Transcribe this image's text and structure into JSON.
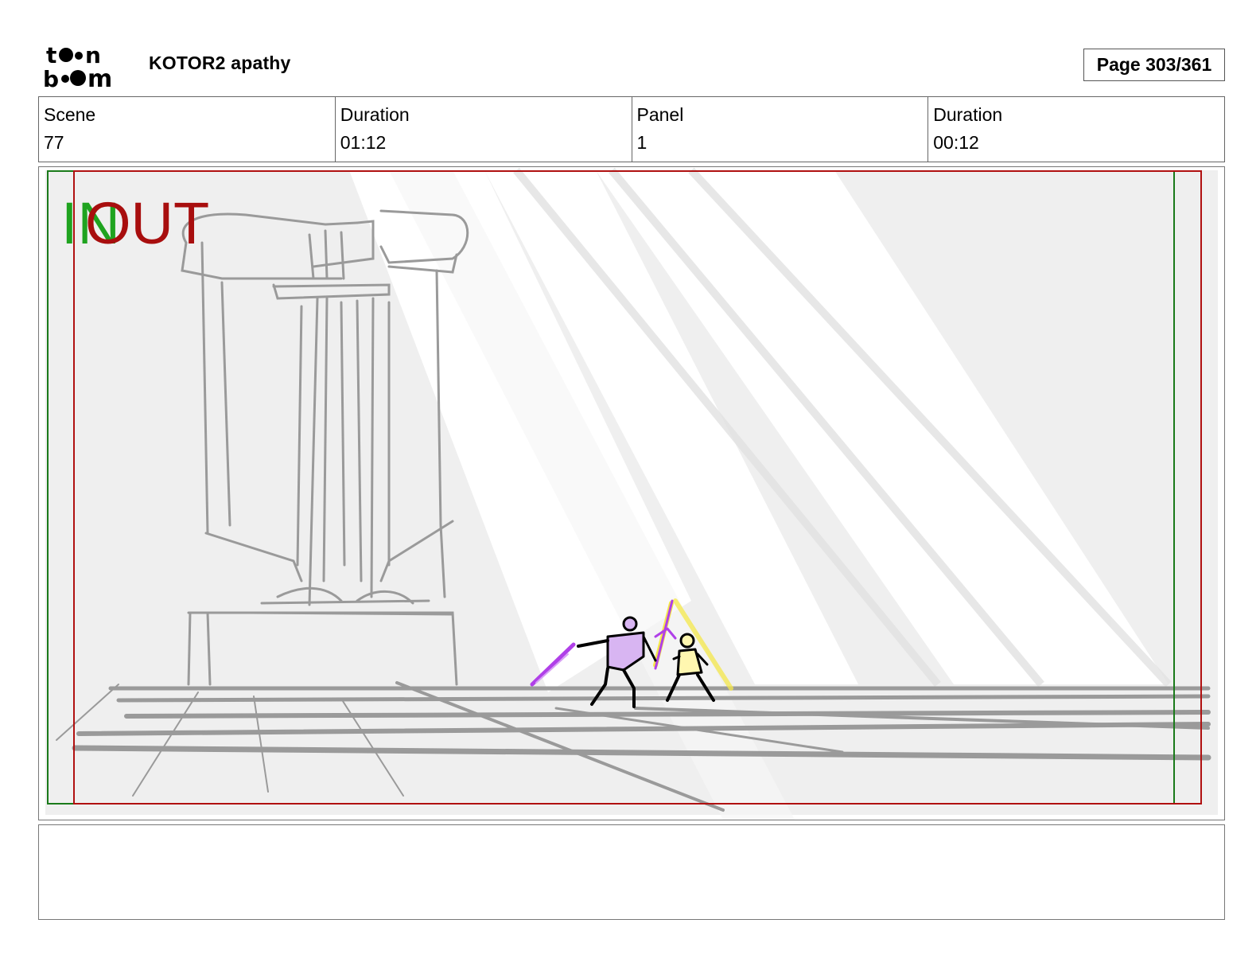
{
  "header": {
    "project_title": "KOTOR2 apathy",
    "page_label": "Page 303/361"
  },
  "info": [
    {
      "label": "Scene",
      "value": "77"
    },
    {
      "label": "Duration",
      "value": "01:12"
    },
    {
      "label": "Panel",
      "value": "1"
    },
    {
      "label": "Duration",
      "value": "00:12"
    }
  ],
  "panel": {
    "in_label": "IN",
    "out_label": "OUT",
    "colors": {
      "in_frame": "#1a7a1a",
      "out_frame": "#b01010",
      "sketch": "#9a9a9a",
      "background": "#efefef",
      "figure_purple": "#b040e8",
      "figure_yellow": "#f5e84a"
    }
  },
  "notes": {
    "text": ""
  }
}
